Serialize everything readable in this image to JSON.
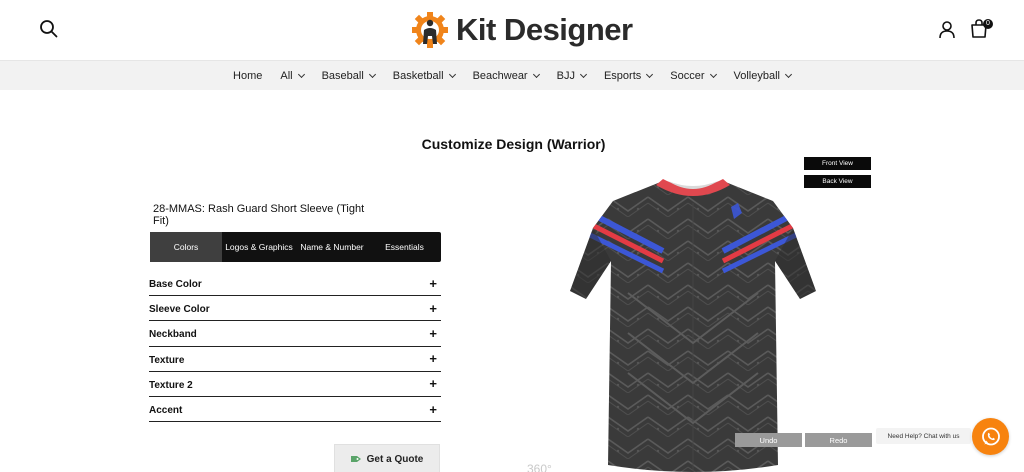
{
  "header": {
    "logo_text": "Kit Designer",
    "cart_count": "0"
  },
  "nav": {
    "items": [
      {
        "label": "Home",
        "has_dropdown": false
      },
      {
        "label": "All",
        "has_dropdown": true
      },
      {
        "label": "Baseball",
        "has_dropdown": true
      },
      {
        "label": "Basketball",
        "has_dropdown": true
      },
      {
        "label": "Beachwear",
        "has_dropdown": true
      },
      {
        "label": "BJJ",
        "has_dropdown": true
      },
      {
        "label": "Esports",
        "has_dropdown": true
      },
      {
        "label": "Soccer",
        "has_dropdown": true
      },
      {
        "label": "Volleyball",
        "has_dropdown": true
      }
    ]
  },
  "main": {
    "title": "Customize Design (Warrior)",
    "product_name": "28-MMAS: Rash Guard Short Sleeve (Tight Fit)",
    "tabs": [
      {
        "label": "Colors",
        "active": true
      },
      {
        "label": "Logos & Graphics",
        "active": false
      },
      {
        "label": "Name & Number",
        "active": false
      },
      {
        "label": "Essentials",
        "active": false
      }
    ],
    "options": [
      {
        "label": "Base Color",
        "icon": "+"
      },
      {
        "label": "Sleeve Color",
        "icon": "+"
      },
      {
        "label": "Neckband",
        "icon": "+"
      },
      {
        "label": "Texture",
        "icon": "+"
      },
      {
        "label": "Texture 2",
        "icon": "+"
      },
      {
        "label": "Accent",
        "icon": "+"
      }
    ],
    "quote_button": "Get a Quote"
  },
  "preview": {
    "front_view": "Front View",
    "back_view": "Back View",
    "undo": "Undo",
    "redo": "Redo",
    "rotate_label": "360°"
  },
  "chat": {
    "label": "Need Help? Chat with us"
  },
  "colors": {
    "shirt_base": "#3a3a3a",
    "collar": "#e0484f",
    "stripe_red": "#e33b44",
    "stripe_blue": "#3c57d6",
    "chat_orange": "#f7830f",
    "logo_orange": "#f0841a"
  }
}
